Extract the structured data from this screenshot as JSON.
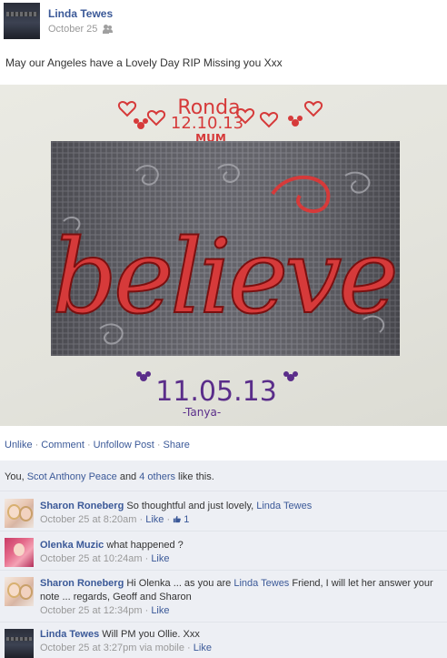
{
  "post": {
    "author": "Linda Tewes",
    "date": "October 25",
    "privacy_icon": "friends-icon",
    "text": "May our Angeles have a Lovely Day RIP Missing you Xxx"
  },
  "photo": {
    "top_name": "Ronda",
    "top_date": "12.10.13",
    "top_label": "MUM",
    "word": "believe",
    "bottom_date": "11.05.13",
    "bottom_name": "-Tanya-",
    "colors": {
      "red": "#d63a3a",
      "purple": "#5a2d8a",
      "canvas": "#5d5d63"
    }
  },
  "actions": {
    "unlike": "Unlike",
    "comment": "Comment",
    "unfollow": "Unfollow Post",
    "share": "Share",
    "separator": "·"
  },
  "likes": {
    "prefix": "You, ",
    "person": "Scot Anthony Peace",
    "middle": " and ",
    "others": "4 others",
    "suffix": " like this."
  },
  "comments": [
    {
      "author": "Sharon Roneberg",
      "text_before": "So thoughtful and just lovely, ",
      "mention": "Linda Tewes",
      "text_after": "",
      "timestamp": "October 25 at 8:20am",
      "sep": "·",
      "like": "Like",
      "sep2": "·",
      "like_count": "1"
    },
    {
      "author": "Olenka Muzic",
      "text": "what happened ?",
      "timestamp": "October 25 at 10:24am",
      "sep": "·",
      "like": "Like"
    },
    {
      "author": "Sharon Roneberg",
      "text_before": "Hi Olenka ... as you are ",
      "mention": "Linda Tewes",
      "text_after": " Friend, I will let her answer your note ... regards, Geoff and Sharon",
      "timestamp": "October 25 at 12:34pm",
      "sep": "·",
      "like": "Like"
    },
    {
      "author": "Linda Tewes",
      "text": "Will PM you Ollie. Xxx",
      "timestamp": "October 25 at 3:27pm via mobile",
      "sep": "·",
      "like": "Like"
    }
  ]
}
